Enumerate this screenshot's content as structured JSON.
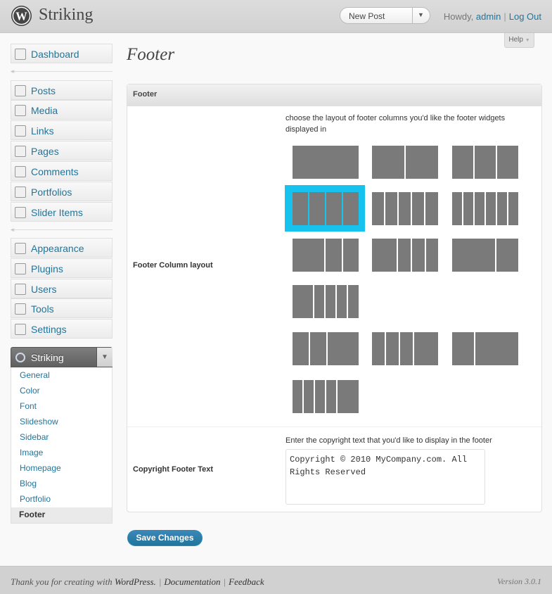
{
  "header": {
    "site_title": "Striking",
    "favorite_action": "New Post",
    "howdy": "Howdy,",
    "user": "admin",
    "logout": "Log Out",
    "help": "Help"
  },
  "menu": {
    "dashboard": "Dashboard",
    "items_1": [
      "Posts",
      "Media",
      "Links",
      "Pages",
      "Comments",
      "Portfolios",
      "Slider Items"
    ],
    "items_2": [
      "Appearance",
      "Plugins",
      "Users",
      "Tools",
      "Settings"
    ],
    "striking": "Striking",
    "submenu": [
      "General",
      "Color",
      "Font",
      "Slideshow",
      "Sidebar",
      "Image",
      "Homepage",
      "Blog",
      "Portfolio",
      "Footer"
    ]
  },
  "page": {
    "title": "Footer",
    "box_title": "Footer",
    "column_layout_label": "Footer Column layout",
    "column_layout_desc": "choose the layout of footer columns you'd like the footer widgets displayed in",
    "selected_layout": "4 equal columns",
    "copyright_label": "Copyright Footer Text",
    "copyright_desc": "Enter the copyright text that you'd like to display in the footer",
    "copyright_value": "Copyright © 2010 MyCompany.com. All Rights Reserved",
    "save_button": "Save Changes"
  },
  "footer": {
    "thanks_prefix": "Thank you for creating with",
    "wordpress": "WordPress.",
    "documentation": "Documentation",
    "feedback": "Feedback",
    "version": "Version 3.0.1"
  },
  "colors": {
    "link": "#21759b",
    "selected_layout_border": "#17c2ef",
    "layout_fill": "#7a7a7a"
  }
}
